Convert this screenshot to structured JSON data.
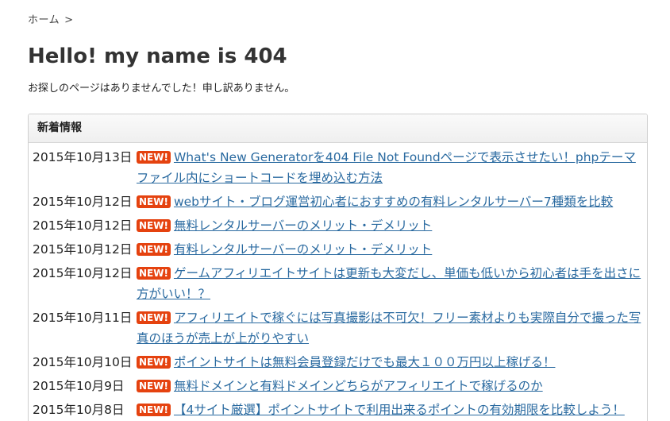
{
  "breadcrumb": {
    "home": "ホーム",
    "separator": ">"
  },
  "page": {
    "title": "Hello! my name is 404",
    "message": "お探しのページはありませんでした！申し訳ありません。"
  },
  "news": {
    "heading": "新着情報",
    "badge": "NEW!",
    "items": [
      {
        "date": "2015年10月13日",
        "title": "What's New Generatorを404 File Not Foundページで表示させたい！phpテーマファイル内にショートコードを埋め込む方法"
      },
      {
        "date": "2015年10月12日",
        "title": "webサイト・ブログ運営初心者におすすめの有料レンタルサーバー7種類を比較"
      },
      {
        "date": "2015年10月12日",
        "title": "無料レンタルサーバーのメリット・デメリット"
      },
      {
        "date": "2015年10月12日",
        "title": "有料レンタルサーバーのメリット・デメリット"
      },
      {
        "date": "2015年10月12日",
        "title": "ゲームアフィリエイトサイトは更新も大変だし、単価も低いから初心者は手を出さに方がいい！？"
      },
      {
        "date": "2015年10月11日",
        "title": "アフィリエイトで稼ぐには写真撮影は不可欠！フリー素材よりも実際自分で撮った写真のほうが売上が上がりやすい"
      },
      {
        "date": "2015年10月10日",
        "title": "ポイントサイトは無料会員登録だけでも最大１００万円以上稼げる！"
      },
      {
        "date": "2015年10月9日",
        "title": "無料ドメインと有料ドメインどちらがアフィリエイトで稼げるのか"
      },
      {
        "date": "2015年10月8日",
        "title": "【4サイト厳選】ポイントサイトで利用出来るポイントの有効期限を比較しよう！"
      }
    ]
  },
  "colors": {
    "badge": "#e5420f",
    "link": "#2a6aa0",
    "panel_border": "#cfcfcf"
  }
}
